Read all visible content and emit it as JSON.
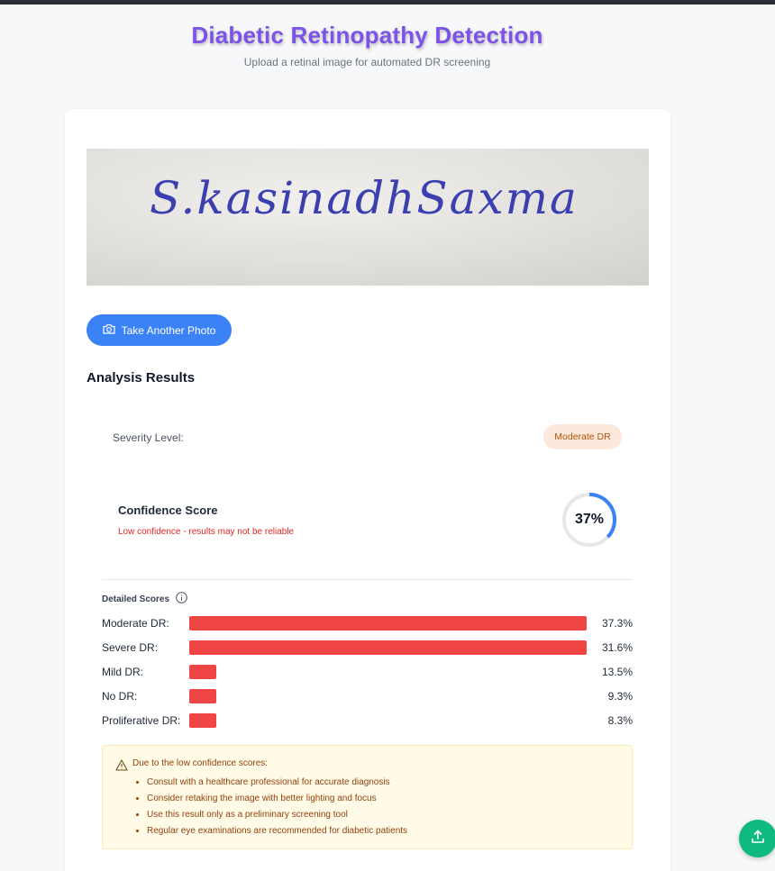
{
  "header": {
    "title": "Diabetic Retinopathy Detection",
    "subtitle": "Upload a retinal image for automated DR screening"
  },
  "preview": {
    "handwriting_text": "S.kasinadhSaxma"
  },
  "actions": {
    "retake_label": "Take Another Photo",
    "retake_icon": "camera-icon",
    "share_icon": "upload-icon"
  },
  "results": {
    "heading": "Analysis Results",
    "severity_label": "Severity Level:",
    "severity_value": "Moderate DR",
    "confidence_title": "Confidence Score",
    "confidence_warning": "Low confidence - results may not be reliable",
    "confidence_percent": 37,
    "confidence_text": "37%",
    "detailed_title": "Detailed Scores",
    "detailed_icon": "info-icon",
    "scores": [
      {
        "label": "Moderate DR:",
        "value": 37.3,
        "value_text": "37.3%"
      },
      {
        "label": "Severe DR:",
        "value": 31.6,
        "value_text": "31.6%"
      },
      {
        "label": "Mild DR:",
        "value": 13.5,
        "value_text": "13.5%"
      },
      {
        "label": "No DR:",
        "value": 9.3,
        "value_text": "9.3%"
      },
      {
        "label": "Proliferative DR:",
        "value": 8.3,
        "value_text": "8.3%"
      }
    ]
  },
  "advice": {
    "icon": "warning-icon",
    "heading": "Due to the low confidence scores:",
    "items": [
      "Consult with a healthcare professional for accurate diagnosis",
      "Consider retaking the image with better lighting and focus",
      "Use this result only as a preliminary screening tool",
      "Regular eye examinations are recommended for diabetic patients"
    ]
  },
  "colors": {
    "title": "#7c52e8",
    "button": "#3b82f6",
    "bar": "#ef4444",
    "gauge": "#3b82f6",
    "badge_bg": "#fde8dc",
    "fab": "#10b981"
  }
}
